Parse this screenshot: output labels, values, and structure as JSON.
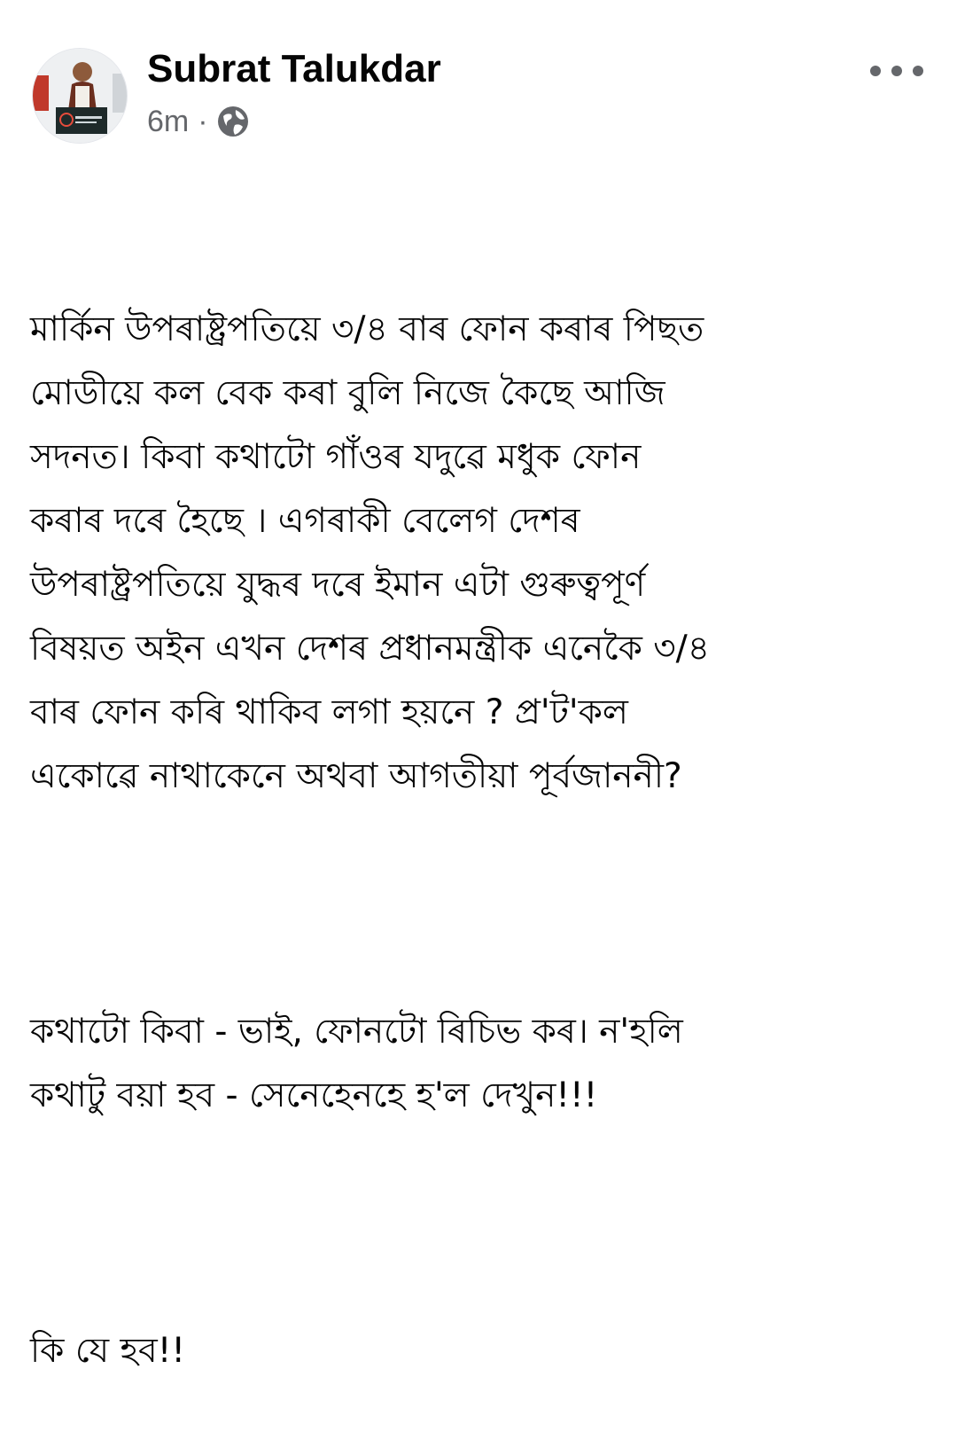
{
  "post": {
    "author": "Subrat Talukdar",
    "time": "6m",
    "separator": "·",
    "privacy_icon": "globe-icon",
    "more_icon": "more-options-icon",
    "avatar_icon": "profile-photo",
    "paragraphs": [
      "মাৰ্কিন উপৰাষ্ট্ৰপতিয়ে ৩/৪ বাৰ ফোন কৰাৰ পিছত\nমোডীয়ে কল বেক কৰা বুলি নিজে কৈছে আজি\nসদনত। কিবা কথাটো গাঁওৰ যদুৱে মধুক ফোন\nকৰাৰ দৰে হৈছে । এগৰাকী বেলেগ দেশৰ\nউপৰাষ্ট্ৰপতিয়ে যুদ্ধৰ দৰে ইমান এটা গুৰুত্বপূৰ্ণ\nবিষয়ত অইন এখন দেশৰ প্ৰধানমন্ত্ৰীক এনেকৈ ৩/৪\nবাৰ ফোন কৰি থাকিব লগা হয়নে ? প্ৰ'ট'কল\nএকোৱে নাথাকেনে অথবা আগতীয়া পূৰ্বজাননী?",
      "কথাটো কিবা - ভাই, ফোনটো ৰিচিভ কৰ। ন'হলি\nকথাটু বয়া হব - সেনেহেনহে হ'ল দেখুন!!!",
      "কি যে হব!!"
    ]
  },
  "colors": {
    "text": "#050505",
    "secondary": "#65676b",
    "background": "#ffffff"
  }
}
